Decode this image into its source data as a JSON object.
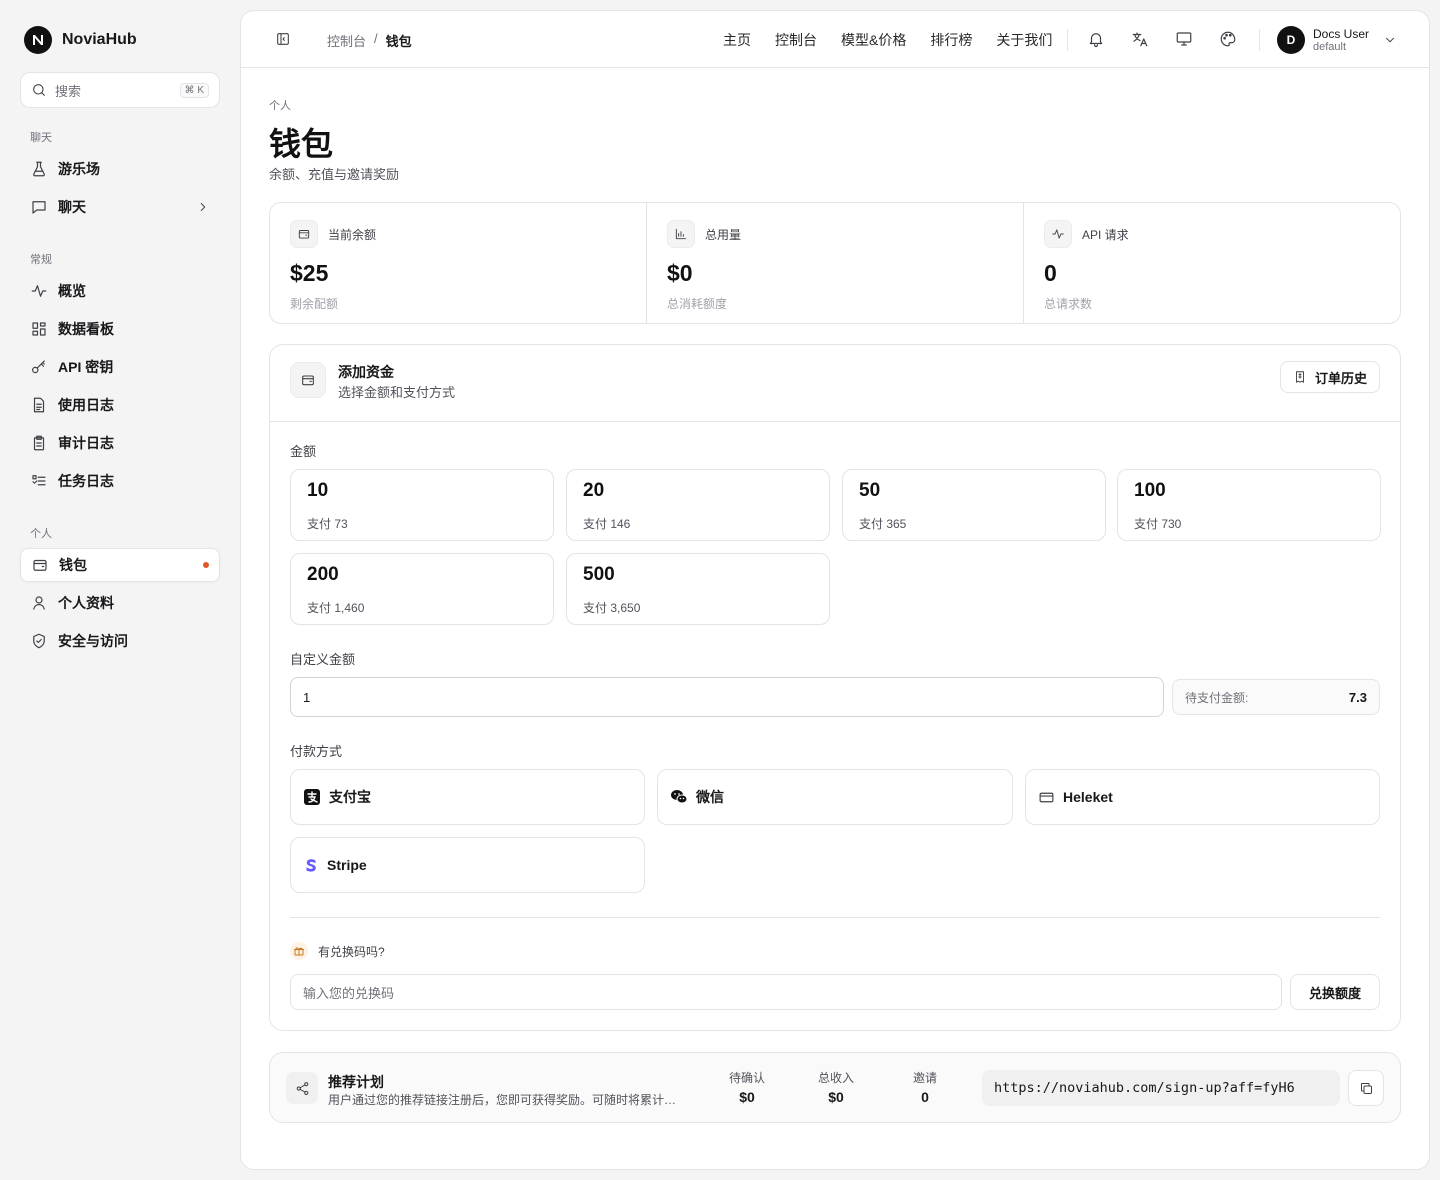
{
  "brand": {
    "name": "NoviaHub"
  },
  "search": {
    "placeholder": "搜索",
    "shortcut": "⌘ K"
  },
  "sidebar": {
    "groups": [
      {
        "title": "聊天",
        "items": [
          {
            "label": "游乐场",
            "icon": "flask-icon"
          },
          {
            "label": "聊天",
            "icon": "chat-icon"
          }
        ]
      },
      {
        "title": "常规",
        "items": [
          {
            "label": "概览",
            "icon": "activity-icon"
          },
          {
            "label": "数据看板",
            "icon": "dashboard-icon"
          },
          {
            "label": "API 密钥",
            "icon": "key-icon"
          },
          {
            "label": "使用日志",
            "icon": "document-icon"
          },
          {
            "label": "审计日志",
            "icon": "clipboard-icon"
          },
          {
            "label": "任务日志",
            "icon": "list-icon"
          }
        ]
      },
      {
        "title": "个人",
        "items": [
          {
            "label": "钱包",
            "icon": "wallet-icon",
            "active": true
          },
          {
            "label": "个人资料",
            "icon": "user-icon"
          },
          {
            "label": "安全与访问",
            "icon": "shield-icon"
          }
        ]
      }
    ]
  },
  "header": {
    "breadcrumb": [
      "控制台",
      "钱包"
    ],
    "breadcrumb_sep": "/",
    "nav": [
      "主页",
      "控制台",
      "模型&价格",
      "排行榜",
      "关于我们"
    ],
    "user": {
      "initial": "D",
      "name": "Docs User",
      "role": "default"
    }
  },
  "page": {
    "eyebrow": "个人",
    "title": "钱包",
    "subtitle": "余额、充值与邀请奖励"
  },
  "stats": [
    {
      "label": "当前余额",
      "value": "$25",
      "hint": "剩余配额",
      "icon": "wallet-icon"
    },
    {
      "label": "总用量",
      "value": "$0",
      "hint": "总消耗额度",
      "icon": "bar-chart-icon"
    },
    {
      "label": "API 请求",
      "value": "0",
      "hint": "总请求数",
      "icon": "activity-icon"
    }
  ],
  "funds": {
    "title": "添加资金",
    "subtitle": "选择金额和支付方式",
    "order_history": "订单历史",
    "amount_label": "金额",
    "amounts": [
      {
        "value": "10",
        "pay": "支付 73"
      },
      {
        "value": "20",
        "pay": "支付 146"
      },
      {
        "value": "50",
        "pay": "支付 365"
      },
      {
        "value": "100",
        "pay": "支付 730"
      },
      {
        "value": "200",
        "pay": "支付 1,460"
      },
      {
        "value": "500",
        "pay": "支付 3,650"
      }
    ],
    "custom_label": "自定义金额",
    "custom_value": "1",
    "pending_label": "待支付金额:",
    "pending_value": "7.3",
    "payment_label": "付款方式",
    "payments": [
      {
        "label": "支付宝",
        "icon": "alipay-icon"
      },
      {
        "label": "微信",
        "icon": "wechat-icon"
      },
      {
        "label": "Heleket",
        "icon": "card-icon"
      },
      {
        "label": "Stripe",
        "icon": "stripe-icon"
      }
    ],
    "redeem_question": "有兑换码吗?",
    "redeem_placeholder": "输入您的兑换码",
    "redeem_button": "兑换额度"
  },
  "referral": {
    "title": "推荐计划",
    "description": "用户通过您的推荐链接注册后，您即可获得奖励。可随时将累计奖励划转到余额",
    "stats": [
      {
        "label": "待确认",
        "value": "$0"
      },
      {
        "label": "总收入",
        "value": "$0"
      },
      {
        "label": "邀请",
        "value": "0"
      }
    ],
    "link": "https://noviahub.com/sign-up?aff=fyH6"
  },
  "colors": {
    "accent_dot": "#e2562b",
    "stripe": "#635bff",
    "gift": "#c2781f"
  }
}
